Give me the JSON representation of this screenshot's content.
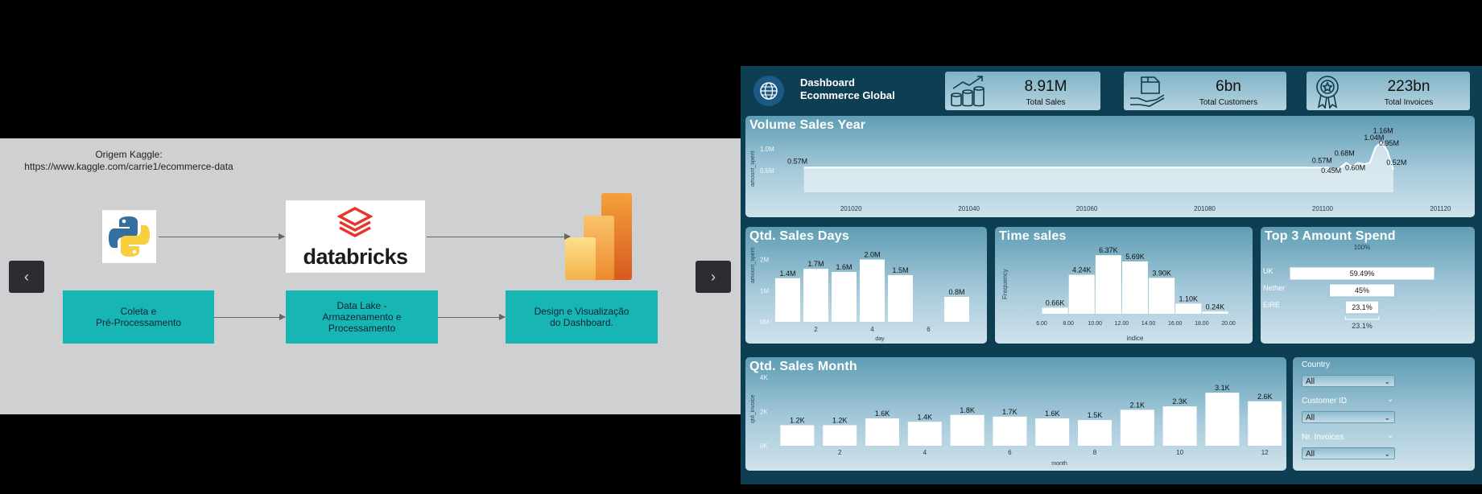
{
  "left": {
    "source_line1": "Origem Kaggle:",
    "source_line2": "https://www.kaggle.com/carrie1/ecommerce-data",
    "databricks_label": "databricks",
    "steps": [
      "Coleta e\nPré-Processamento",
      "Data Lake -\nArmazenamento e\nProcessamento",
      "Design e Visualização\ndo Dashboard."
    ],
    "prev_label": "‹",
    "next_label": "›"
  },
  "dashboard": {
    "title_line1": "Dashboard",
    "title_line2": "Ecommerce Global",
    "kpis": [
      {
        "value": "8.91M",
        "label": "Total Sales",
        "icon": "money-growth-icon"
      },
      {
        "value": "6bn",
        "label": "Total Customers",
        "icon": "hand-box-icon"
      },
      {
        "value": "223bn",
        "label": "Total Invoices",
        "icon": "award-ribbon-icon"
      }
    ],
    "colors": {
      "background": "#0e3e52",
      "panel": "#a6cadb",
      "bar": "#ffffff"
    }
  },
  "volume_sales_year": {
    "title": "Volume Sales Year",
    "ylabel": "amount_spent",
    "yticks": [
      "1.0M",
      "0.5M"
    ],
    "xticks": [
      "201020",
      "201040",
      "201060",
      "201080",
      "201100",
      "201120"
    ],
    "labels": [
      "0.57M",
      "0.57M",
      "0.45M",
      "0.68M",
      "0.60M",
      "1.04M",
      "1.16M",
      "0.95M",
      "0.52M"
    ]
  },
  "qtd_sales_days": {
    "title": "Qtd. Sales Days",
    "ylabel": "amount_spent",
    "xlabel": "day",
    "yticks": [
      "2M",
      "1M",
      "0M"
    ],
    "xticks": [
      "2",
      "4",
      "6"
    ]
  },
  "time_sales": {
    "title": "Time sales",
    "ylabel": "Frequency",
    "xlabel": "indice",
    "xticks": [
      "6.00",
      "8.00",
      "10.00",
      "12.00",
      "14.00",
      "16.00",
      "18.00",
      "20.00"
    ]
  },
  "top3": {
    "title": "Top 3 Amount Spend",
    "top_label": "100%",
    "bottom_label": "23.1%",
    "rows": [
      {
        "name": "UK",
        "pct_label": "59.49%",
        "fraction": 1.0
      },
      {
        "name": "Nether",
        "pct_label": "45%",
        "fraction": 0.45
      },
      {
        "name": "EIRE",
        "pct_label": "23.1%",
        "fraction": 0.231
      }
    ]
  },
  "qtd_sales_month": {
    "title": "Qtd. Sales Month",
    "ylabel": "qtd_invoice",
    "xlabel": "month",
    "yticks": [
      "4K",
      "2K",
      "0K"
    ],
    "xticks": [
      "2",
      "4",
      "6",
      "8",
      "10",
      "12"
    ]
  },
  "slicers": [
    {
      "label": "Country",
      "value": "All"
    },
    {
      "label": "Customer ID",
      "value": "All"
    },
    {
      "label": "Nr. Invoices",
      "value": "All"
    }
  ],
  "chart_data": [
    {
      "type": "line",
      "title": "Volume Sales Year",
      "ylabel": "amount_spent",
      "xlim": [
        201010,
        201125
      ],
      "ylim": [
        0,
        1.3
      ],
      "x": [
        201012,
        201101,
        201102,
        201103,
        201104,
        201105,
        201106,
        201107,
        201108,
        201109,
        201110,
        201111,
        201112
      ],
      "values": [
        0.57,
        0.57,
        0.45,
        0.57,
        0.68,
        0.6,
        0.68,
        0.65,
        0.68,
        1.04,
        1.16,
        0.95,
        0.52
      ]
    },
    {
      "type": "bar",
      "title": "Qtd. Sales Days",
      "xlabel": "day",
      "ylabel": "amount_spent",
      "categories": [
        1,
        2,
        3,
        4,
        5,
        7
      ],
      "values": [
        1.4,
        1.7,
        1.6,
        2.0,
        1.5,
        0.8
      ],
      "value_labels": [
        "1.4M",
        "1.7M",
        "1.6M",
        "2.0M",
        "1.5M",
        "0.8M"
      ],
      "ylim": [
        0,
        2.4
      ]
    },
    {
      "type": "bar",
      "title": "Time sales",
      "xlabel": "indice",
      "ylabel": "Frequency",
      "bins": [
        7,
        9,
        11,
        13,
        15,
        17,
        19
      ],
      "values": [
        0.66,
        4.24,
        6.37,
        5.69,
        3.9,
        1.1,
        0.24
      ],
      "value_labels": [
        "0.66K",
        "4.24K",
        "6.37K",
        "5.69K",
        "3.90K",
        "1.10K",
        "0.24K"
      ],
      "xlim": [
        6,
        20
      ],
      "ylim": [
        0,
        7
      ]
    },
    {
      "type": "bar",
      "title": "Qtd. Sales Month",
      "xlabel": "month",
      "ylabel": "qtd_invoice",
      "categories": [
        1,
        2,
        3,
        4,
        5,
        6,
        7,
        8,
        9,
        10,
        11,
        12
      ],
      "values": [
        1.2,
        1.2,
        1.6,
        1.4,
        1.8,
        1.7,
        1.6,
        1.5,
        2.1,
        2.3,
        3.1,
        2.6
      ],
      "value_labels": [
        "1.2K",
        "1.2K",
        "1.6K",
        "1.4K",
        "1.8K",
        "1.7K",
        "1.6K",
        "1.5K",
        "2.1K",
        "2.3K",
        "3.1K",
        "2.6K"
      ],
      "ylim": [
        0,
        4
      ]
    }
  ]
}
